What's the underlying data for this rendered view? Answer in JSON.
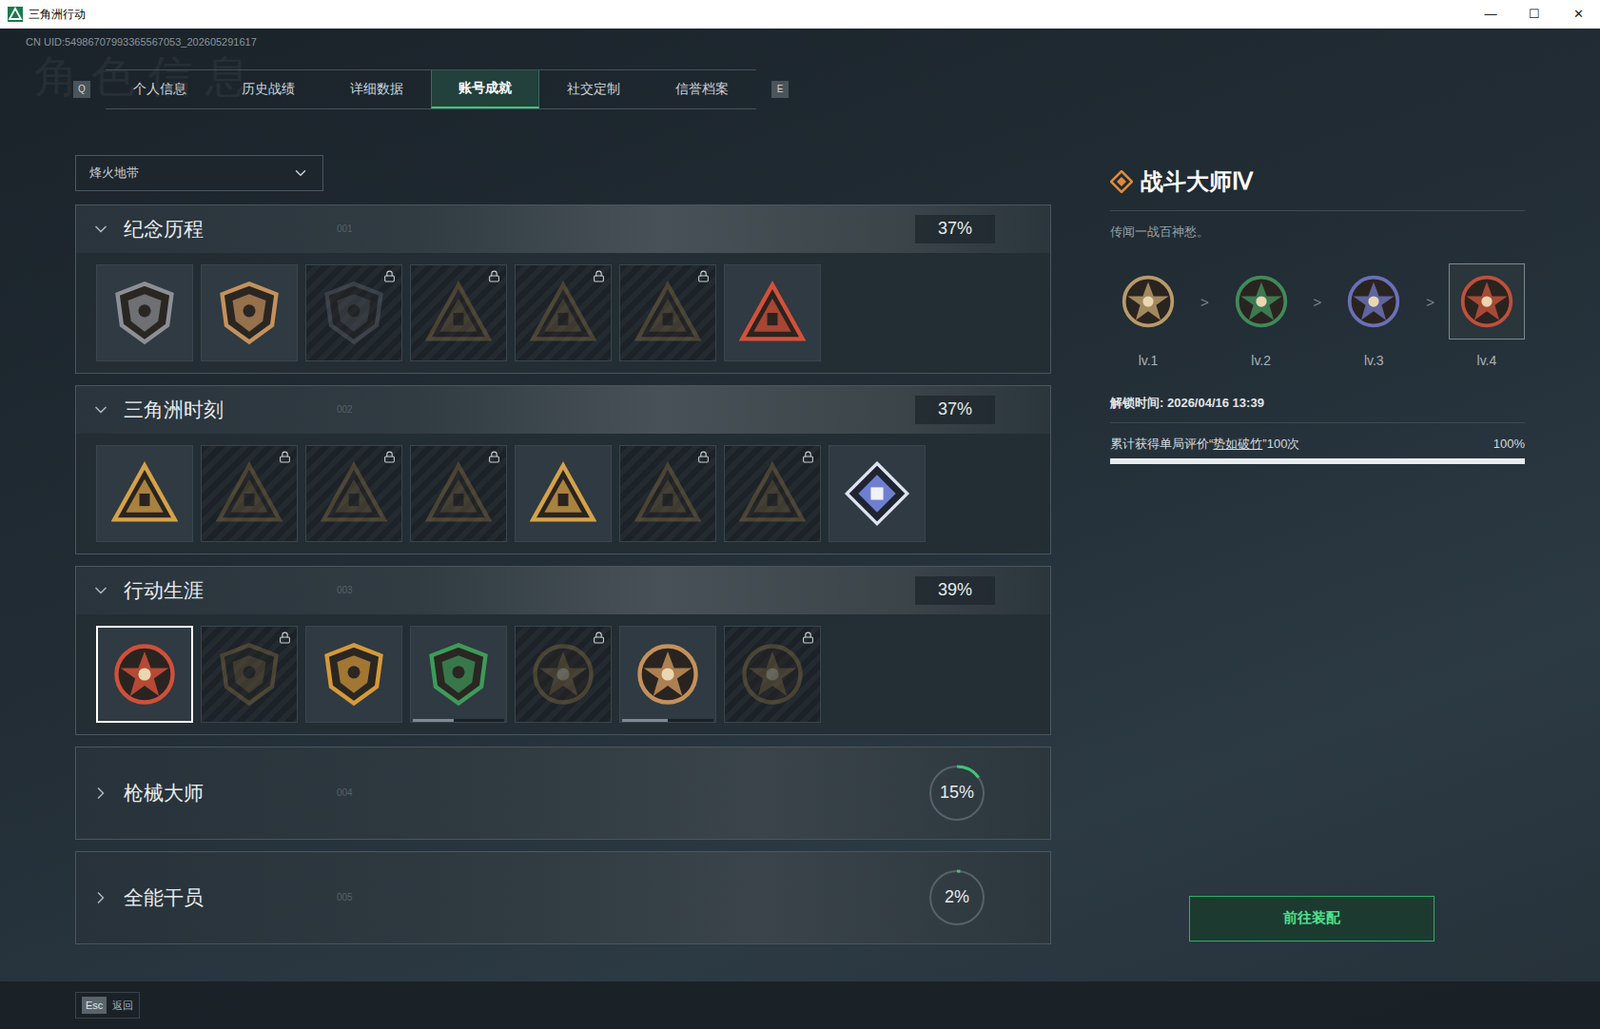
{
  "window": {
    "title": "三角洲行动",
    "controls": [
      "—",
      "☐",
      "✕"
    ]
  },
  "uid": "CN UID:54986707993365567053_202605291617",
  "watermark": "角色信息",
  "tabs": {
    "prev_key": "Q",
    "next_key": "E",
    "items": [
      {
        "label": "个人信息",
        "selected": false
      },
      {
        "label": "历史战绩",
        "selected": false
      },
      {
        "label": "详细数据",
        "selected": false
      },
      {
        "label": "账号成就",
        "selected": true
      },
      {
        "label": "社交定制",
        "selected": false
      },
      {
        "label": "信誉档案",
        "selected": false
      }
    ]
  },
  "mode_select": {
    "value": "烽火地带"
  },
  "sections": [
    {
      "title": "纪念历程",
      "code": "001",
      "percent": "37%",
      "level": 0.37,
      "expanded": true,
      "items": [
        {
          "kind": "shield",
          "locked": false,
          "selected": false,
          "color": "#8c9096"
        },
        {
          "kind": "shield",
          "locked": false,
          "selected": false,
          "color": "#c4915c"
        },
        {
          "kind": "shield",
          "locked": true,
          "selected": false,
          "color": "#707680"
        },
        {
          "kind": "triangle",
          "locked": true,
          "selected": false,
          "color": "#a0804a"
        },
        {
          "kind": "triangle",
          "locked": true,
          "selected": false,
          "color": "#a0804a"
        },
        {
          "kind": "triangle",
          "locked": true,
          "selected": false,
          "color": "#a0804a"
        },
        {
          "kind": "triangle",
          "locked": false,
          "selected": false,
          "color": "#d4503a"
        }
      ]
    },
    {
      "title": "三角洲时刻",
      "code": "002",
      "percent": "37%",
      "level": 0.37,
      "expanded": true,
      "items": [
        {
          "kind": "triangle",
          "locked": false,
          "selected": false,
          "color": "#d4a24a"
        },
        {
          "kind": "triangle",
          "locked": true,
          "selected": false,
          "color": "#a0804a"
        },
        {
          "kind": "triangle",
          "locked": true,
          "selected": false,
          "color": "#a0804a"
        },
        {
          "kind": "triangle",
          "locked": true,
          "selected": false,
          "color": "#a0804a"
        },
        {
          "kind": "triangle",
          "locked": false,
          "selected": false,
          "color": "#d4a24a"
        },
        {
          "kind": "triangle",
          "locked": true,
          "selected": false,
          "color": "#a0804a"
        },
        {
          "kind": "triangle",
          "locked": true,
          "selected": false,
          "color": "#a0804a"
        },
        {
          "kind": "diamond",
          "locked": false,
          "selected": false,
          "color": "#6f7fd0"
        }
      ]
    },
    {
      "title": "行动生涯",
      "code": "003",
      "percent": "39%",
      "level": 0.39,
      "expanded": true,
      "items": [
        {
          "kind": "round",
          "locked": false,
          "selected": true,
          "color": "#d0503a"
        },
        {
          "kind": "shield",
          "locked": true,
          "selected": false,
          "color": "#a0804a"
        },
        {
          "kind": "shield",
          "locked": false,
          "selected": false,
          "color": "#d49a3a"
        },
        {
          "kind": "shield",
          "locked": false,
          "selected": false,
          "color": "#3f9a5a",
          "level": 0.45
        },
        {
          "kind": "round",
          "locked": true,
          "selected": false,
          "color": "#a0804a"
        },
        {
          "kind": "round",
          "locked": false,
          "selected": false,
          "color": "#c4915c",
          "level": 0.5
        },
        {
          "kind": "round",
          "locked": true,
          "selected": false,
          "color": "#a0804a"
        }
      ]
    },
    {
      "title": "枪械大师",
      "code": "004",
      "percent": "15%",
      "level": 0.15,
      "expanded": false,
      "items": []
    },
    {
      "title": "全能干员",
      "code": "005",
      "percent": "2%",
      "level": 0.02,
      "expanded": false,
      "items": []
    }
  ],
  "detail": {
    "title": "战斗大师Ⅳ",
    "subtitle": "传闻一战百神愁。",
    "levels": [
      {
        "label": "lv.1",
        "color": "#b89a6a",
        "selected": false
      },
      {
        "label": "lv.2",
        "color": "#3f8a5a",
        "selected": false
      },
      {
        "label": "lv.3",
        "color": "#6a70b8",
        "selected": false
      },
      {
        "label": "lv.4",
        "color": "#c0503a",
        "selected": true
      }
    ],
    "separator": ">",
    "unlock_time": "解锁时间: 2026/04/16 13:39",
    "task": {
      "before": "累计获得单局评价“",
      "link": "势如破竹",
      "after": "”100次",
      "percent": "100%",
      "level": 1
    },
    "button": "前往装配"
  },
  "footer": {
    "key": "Esc",
    "label": "返回"
  }
}
